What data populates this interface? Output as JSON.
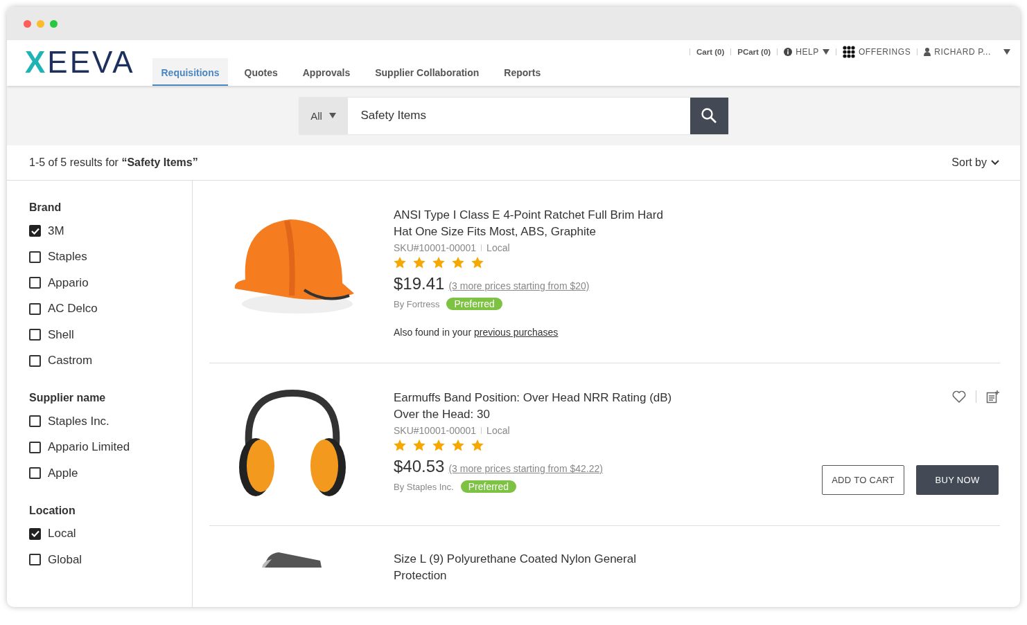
{
  "logo": "XEEVA",
  "nav_tabs": [
    {
      "label": "Requisitions",
      "selected": true
    },
    {
      "label": "Quotes",
      "selected": false
    },
    {
      "label": "Approvals",
      "selected": false
    },
    {
      "label": "Supplier Collaboration",
      "selected": false
    },
    {
      "label": "Reports",
      "selected": false
    }
  ],
  "top_links": {
    "cart": "Cart (0)",
    "pcart": "PCart (0)",
    "help": "HELP",
    "offerings": "OFFERINGS",
    "user": "RICHARD P..."
  },
  "search": {
    "scope": "All",
    "value": "Safety Items"
  },
  "results_summary": "1-5 of 5 results for **“Safety Items”**",
  "sort_label": "Sort by",
  "filters": [
    {
      "title": "Brand",
      "options": [
        {
          "label": "3M",
          "checked": true
        },
        {
          "label": "Staples",
          "checked": false
        },
        {
          "label": "Appario",
          "checked": false
        },
        {
          "label": "AC Delco",
          "checked": false
        },
        {
          "label": "Shell",
          "checked": false
        },
        {
          "label": "Castrom",
          "checked": false
        }
      ]
    },
    {
      "title": "Supplier name",
      "options": [
        {
          "label": "Staples Inc.",
          "checked": false
        },
        {
          "label": "Appario Limited",
          "checked": false
        },
        {
          "label": "Apple",
          "checked": false
        }
      ]
    },
    {
      "title": "Location",
      "options": [
        {
          "label": "Local",
          "checked": true
        },
        {
          "label": "Global",
          "checked": false
        }
      ]
    }
  ],
  "products": [
    {
      "kind": "hardhat",
      "title": "ANSI Type I Class E 4-Point Ratchet Full Brim Hard Hat One Size Fits Most, ABS, Graphite",
      "sku": "SKU#10001-00001",
      "location": "Local",
      "stars": 5,
      "price": "$19.41",
      "more_prices": "(3 more prices starting from $20)",
      "supplier": "By Fortress",
      "badge": "Preferred",
      "also_found": "Also found in your",
      "also_found_link": "previous purchases"
    },
    {
      "kind": "earmuffs",
      "title": "Earmuffs Band Position: Over Head NRR Rating (dB) Over the Head: 30",
      "sku": "SKU#10001-00001",
      "location": "Local",
      "stars": 5,
      "price": "$40.53",
      "more_prices": "(3 more prices starting from $42.22)",
      "supplier": "By Staples Inc.",
      "badge": "Preferred",
      "add_to_cart": "ADD TO CART",
      "buy_now": "BUY NOW"
    },
    {
      "kind": "glove",
      "title": "Size L (9) Polyurethane Coated Nylon General Protection"
    }
  ]
}
